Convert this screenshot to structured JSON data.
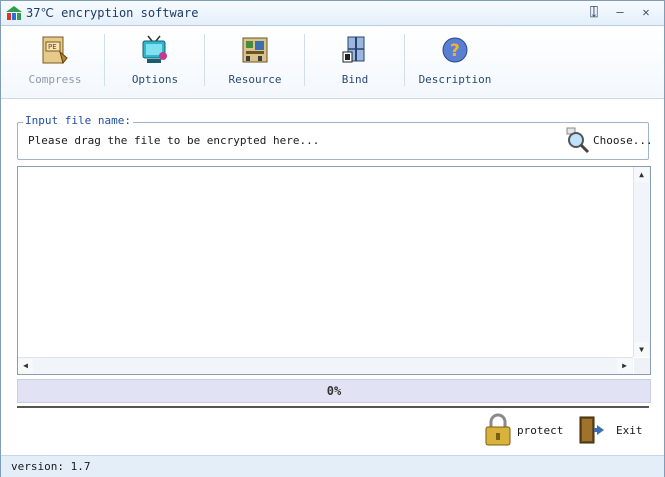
{
  "window": {
    "title": "37℃ encryption software",
    "controls": {
      "pin": "⍗",
      "minimize": "—",
      "close": "✕"
    }
  },
  "toolbar": {
    "items": [
      {
        "label": "Compress",
        "icon": "compress-icon",
        "enabled": false
      },
      {
        "label": "Options",
        "icon": "options-icon",
        "enabled": true
      },
      {
        "label": "Resource",
        "icon": "resource-icon",
        "enabled": true
      },
      {
        "label": "Bind",
        "icon": "bind-icon",
        "enabled": true
      },
      {
        "label": "Description",
        "icon": "help-icon",
        "enabled": true
      }
    ]
  },
  "input": {
    "legend": "Input file name:",
    "placeholder": "Please drag the file to be encrypted here...",
    "choose_label": "Choose..."
  },
  "progress": {
    "value": 0,
    "text": "0%"
  },
  "actions": {
    "protect_label": "protect",
    "exit_label": "Exit"
  },
  "status": {
    "version": "version: 1.7"
  },
  "colors": {
    "accent": "#1f4f9b",
    "progress_track": "#e2e2f5",
    "titlebar": "#e4effa"
  }
}
